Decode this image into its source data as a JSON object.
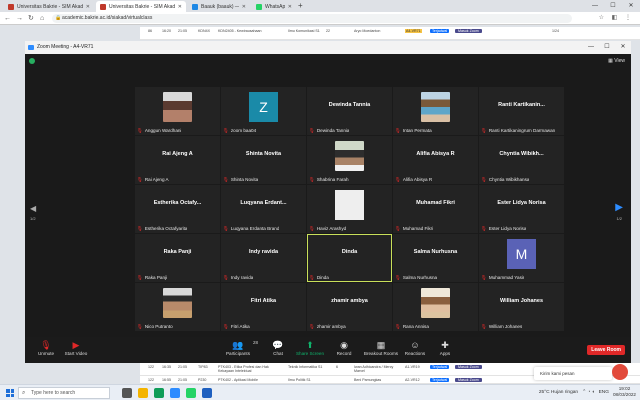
{
  "browser": {
    "tabs": [
      {
        "label": "Universitas Bakrie - SIM Akadem",
        "color": "#c0392b",
        "active": false
      },
      {
        "label": "Universitas Bakrie - SIM Akadem",
        "color": "#c0392b",
        "active": true
      },
      {
        "label": "Baauk (baauk) — ImgBB",
        "color": "#1e88e5",
        "active": false
      },
      {
        "label": "WhatsApp",
        "color": "#25d366",
        "active": false
      }
    ],
    "url": "academic.bakrie.ac.id/siakad/virtualclass"
  },
  "web_table": {
    "top_row": [
      "86",
      "16:20",
      "21:05",
      "KDN4X",
      "KDN2405 - Kewirausahaan",
      "Ilmu Komunikasi S1",
      "22",
      "Aryo Moedanton",
      "A4-VR71",
      "Terjadwal",
      "Masuk Zoom",
      "1/24"
    ],
    "bottom_rows": [
      [
        "122",
        "16:35",
        "21:05",
        "TIP83",
        "PTK403 - Etika Profesi dan Hak Kekayaan Intelektual",
        "Teknik Informatika S1",
        "6",
        "Iwan Adhicandra / Mercy Marvel",
        "A1-VR19",
        "Terjadwal",
        "Masuk Zoom"
      ],
      [
        "122",
        "16:55",
        "21:05",
        "P230",
        "PTK402 - Aplikasi Mobile",
        "Ilmu Politik S1",
        "",
        "Beni Pamungkas",
        "A2-VR12",
        "Terjadwal",
        "Masuk Zoom"
      ]
    ]
  },
  "zoom": {
    "window_title": "Zoom Meeting - A4-VR71",
    "view_label": "View",
    "page_left": "1/2",
    "page_right": "1/2",
    "tiles": [
      {
        "display": "photo",
        "photo": "ph1",
        "label": "Anggun Wardhani",
        "muted": true
      },
      {
        "display": "letter",
        "letter": "Z",
        "label": "zoom baa04",
        "muted": true
      },
      {
        "display": "name",
        "name": "Dewinda Tannia",
        "label": "Dewinda Tannia",
        "muted": true
      },
      {
        "display": "photo",
        "photo": "ph2",
        "label": "Intan Permata",
        "muted": true
      },
      {
        "display": "name",
        "name": "Ranti Kartikanin...",
        "label": "Ranti Kartikaningrum Darmawan",
        "muted": true
      },
      {
        "display": "name",
        "name": "Rai Ajeng A",
        "label": "Rai Ajeng A",
        "muted": true
      },
      {
        "display": "name",
        "name": "Shinta Novita",
        "label": "Shinta Novita",
        "muted": true
      },
      {
        "display": "photo",
        "photo": "ph3",
        "label": "Shabrina Farah",
        "muted": true
      },
      {
        "display": "name",
        "name": "Alifia Abisya R",
        "label": "Alifia Abisya R",
        "muted": true
      },
      {
        "display": "name",
        "name": "Chyntia Wibikh...",
        "label": "Chyntia Wibikhansa",
        "muted": true
      },
      {
        "display": "name",
        "name": "Estherika Octafy...",
        "label": "Estherika Octafyarita",
        "muted": true
      },
      {
        "display": "name",
        "name": "Luqyana Erdant...",
        "label": "Luqyana Erdanta Brand",
        "muted": true
      },
      {
        "display": "blank",
        "label": "Haviz Arashyd",
        "muted": true
      },
      {
        "display": "name",
        "name": "Muhamad Fikri",
        "label": "Muhamad Fikri",
        "muted": true
      },
      {
        "display": "name",
        "name": "Ester Lidya Norisa",
        "label": "Ester Lidya Norisa",
        "muted": true
      },
      {
        "display": "name",
        "name": "Raka Panji",
        "label": "Raka Panji",
        "muted": true
      },
      {
        "display": "name",
        "name": "Indy ravida",
        "label": "Indy ravida",
        "muted": true
      },
      {
        "display": "name",
        "name": "Dinda",
        "label": "Dinda",
        "muted": true,
        "speaking": true
      },
      {
        "display": "name",
        "name": "Salma Nurhusna",
        "label": "Salma Nurhusna",
        "muted": true
      },
      {
        "display": "letter2",
        "letter": "M",
        "label": "Muhammad Yasir",
        "muted": true
      },
      {
        "display": "photo",
        "photo": "ph4",
        "label": "Nico Putranto",
        "muted": true
      },
      {
        "display": "name",
        "name": "Fitri Atika",
        "label": "Fitri Atika",
        "muted": true
      },
      {
        "display": "name",
        "name": "zhamir ambya",
        "label": "zhamir ambya",
        "muted": true
      },
      {
        "display": "photo",
        "photo": "ph5",
        "label": "Rana Annisa",
        "muted": true
      },
      {
        "display": "name",
        "name": "William Johanes",
        "label": "William Johanes",
        "muted": true
      }
    ],
    "toolbar": {
      "unmute": "Unmute",
      "start_video": "Start Video",
      "participants": "Participants",
      "participants_count": "28",
      "chat": "Chat",
      "share_screen": "Share Screen",
      "record": "Record",
      "breakout_rooms": "Breakout Rooms",
      "reactions": "Reactions",
      "apps": "Apps",
      "leave": "Leave Room"
    }
  },
  "chat_widget": {
    "label": "Kirim kami pesan"
  },
  "taskbar": {
    "search_placeholder": "Type here to search",
    "weather": "25°C  Hujan ringan",
    "lang": "ENG",
    "time": "19:02",
    "date": "08/03/2022"
  }
}
